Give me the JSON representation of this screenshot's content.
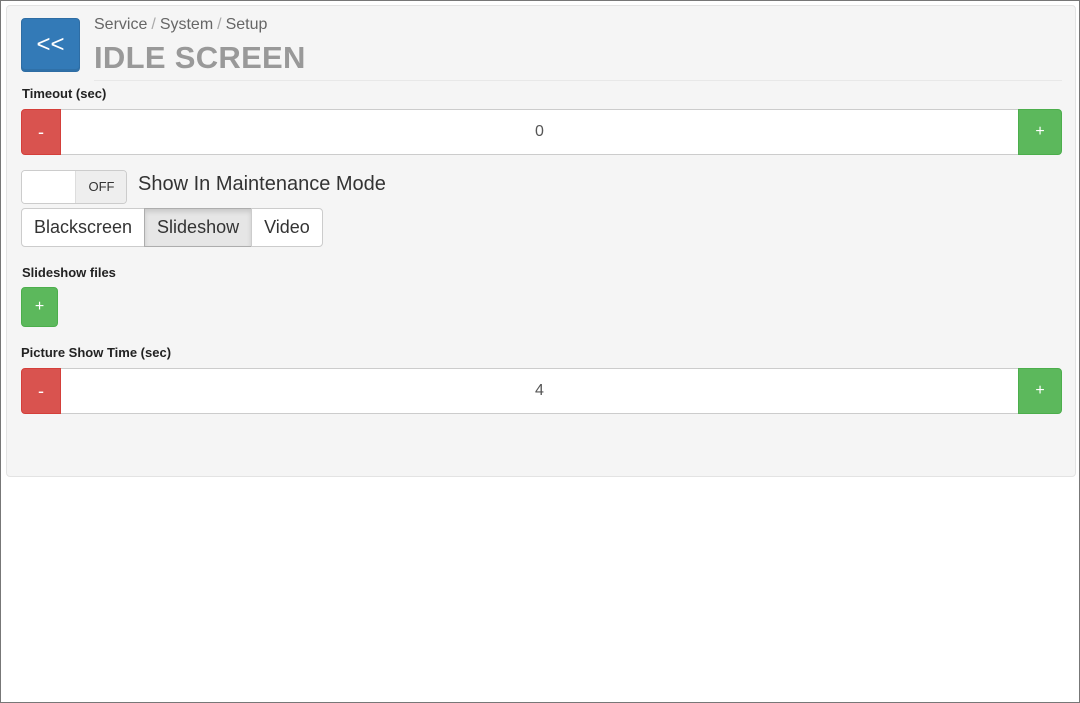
{
  "header": {
    "back_label": "<<",
    "breadcrumb": [
      "Service",
      "System",
      "Setup"
    ],
    "breadcrumb_separator": "/",
    "title": "IDLE SCREEN"
  },
  "timeout": {
    "label": "Timeout (sec)",
    "minus_label": "-",
    "value": "0",
    "plus_label": "+"
  },
  "maintenance": {
    "toggle_state": "OFF",
    "label": "Show In Maintenance Mode"
  },
  "mode": {
    "options": [
      "Blackscreen",
      "Slideshow",
      "Video"
    ],
    "selected": "Slideshow"
  },
  "slideshow_files": {
    "label": "Slideshow files",
    "add_label": "+"
  },
  "picture_show_time": {
    "label": "Picture Show Time (sec)",
    "minus_label": "-",
    "value": "4",
    "plus_label": "+"
  },
  "colors": {
    "primary": "#337ab7",
    "danger": "#d9534f",
    "success": "#5cb85c",
    "panel": "#f5f5f5"
  }
}
